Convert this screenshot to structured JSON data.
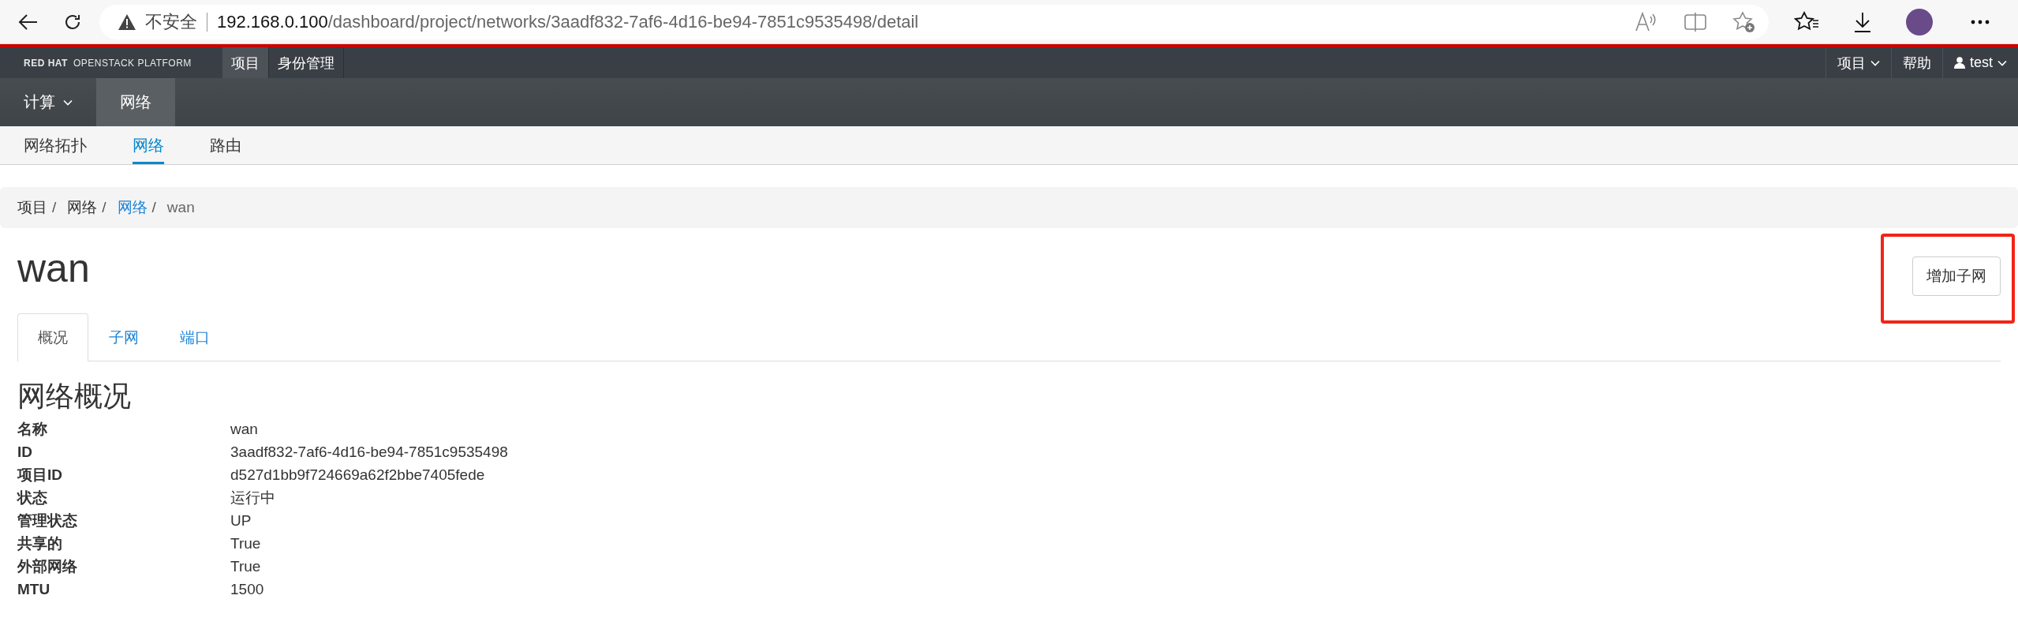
{
  "browser": {
    "insecure_label": "不安全",
    "url_host": "192.168.0.100",
    "url_path": "/dashboard/project/networks/3aadf832-7af6-4d16-be94-7851c9535498/detail"
  },
  "top_nav": {
    "brand": "**RED HAT** OPENSTACK PLATFORM",
    "items": [
      {
        "label": "项目",
        "selected": true
      },
      {
        "label": "身份管理",
        "selected": false
      }
    ],
    "right": [
      {
        "label": "项目",
        "kind": "dropdown"
      },
      {
        "label": "帮助",
        "kind": "link"
      },
      {
        "label": "test",
        "kind": "user"
      }
    ]
  },
  "panel_tabs": [
    {
      "label": "计算",
      "kind": "dropdown",
      "selected": false
    },
    {
      "label": "网络",
      "kind": "plain",
      "selected": true
    }
  ],
  "sub_nav": [
    {
      "label": "网络拓扑",
      "selected": false
    },
    {
      "label": "网络",
      "selected": true
    },
    {
      "label": "路由",
      "selected": false
    }
  ],
  "breadcrumb_separator": "/",
  "breadcrumb": [
    {
      "label": "项目",
      "kind": "text"
    },
    {
      "label": "网络",
      "kind": "text"
    },
    {
      "label": "网络",
      "kind": "link"
    },
    {
      "label": "wan",
      "kind": "current"
    }
  ],
  "page_title": "wan",
  "action_button": "增加子网",
  "tabs": [
    {
      "label": "概况",
      "selected": true
    },
    {
      "label": "子网",
      "selected": false
    },
    {
      "label": "端口",
      "selected": false
    }
  ],
  "section_title": "网络概况",
  "details": [
    {
      "label": "名称",
      "value": "wan"
    },
    {
      "label": "ID",
      "value": "3aadf832-7af6-4d16-be94-7851c9535498"
    },
    {
      "label": "项目ID",
      "value": "d527d1bb9f724669a62f2bbe7405fede"
    },
    {
      "label": "状态",
      "value": "运行中"
    },
    {
      "label": "管理状态",
      "value": "UP"
    },
    {
      "label": "共享的",
      "value": "True"
    },
    {
      "label": "外部网络",
      "value": "True"
    },
    {
      "label": "MTU",
      "value": "1500"
    }
  ]
}
